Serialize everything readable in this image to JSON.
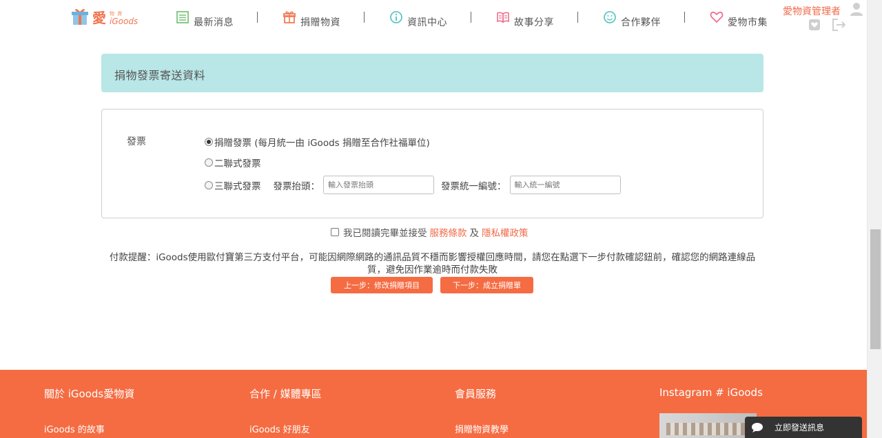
{
  "header": {
    "logo": {
      "main": "愛",
      "sub_top": "物 資",
      "sub_bottom": "iGoods"
    },
    "nav": [
      {
        "label": "最新消息",
        "icon": "news-list-icon"
      },
      {
        "label": "捐贈物資",
        "icon": "gift-box-icon"
      },
      {
        "label": "資訊中心",
        "icon": "info-circle-icon"
      },
      {
        "label": "故事分享",
        "icon": "open-book-icon"
      },
      {
        "label": "合作夥伴",
        "icon": "smile-face-icon"
      },
      {
        "label": "愛物市集",
        "icon": "heart-icon"
      }
    ],
    "user_name": "愛物資管理者"
  },
  "section": {
    "title": "捐物發票寄送資料"
  },
  "invoice": {
    "label": "發票",
    "options": [
      {
        "label": "捐贈發票 (每月統一由 iGoods 捐贈至合作社福單位)",
        "selected": true
      },
      {
        "label": "二聯式發票",
        "selected": false
      },
      {
        "label": "三聯式發票",
        "selected": false
      }
    ],
    "title_label": "發票抬頭：",
    "title_placeholder": "輸入發票抬頭",
    "taxid_label": "發票統一編號：",
    "taxid_placeholder": "輸入統一編號"
  },
  "agreement": {
    "prefix": "我已閱讀完畢並接受",
    "terms_link": "服務條款",
    "and": "及",
    "privacy_link": "隱私權政策",
    "checked": false
  },
  "notice": "付款提醒：iGoods使用歐付寶第三方支付平台，可能因網際網路的通訊品質不穩而影響授權回應時間，請您在點選下一步付款確認鈕前，確認您的網路連線品質，避免因作業逾時而付款失敗",
  "buttons": {
    "prev": "上一步：修改捐贈項目",
    "next": "下一步：成立捐贈單"
  },
  "footer": {
    "columns": [
      {
        "title": "關於 iGoods愛物資",
        "first_item": "iGoods 的故事"
      },
      {
        "title": "合作 / 媒體專區",
        "first_item": "iGoods 好朋友"
      },
      {
        "title": "會員服務",
        "first_item": "捐贈物資教學"
      },
      {
        "title": "Instagram # iGoods",
        "first_item": ""
      }
    ]
  },
  "chat": {
    "label": "立即發送訊息"
  },
  "colors": {
    "accent": "#f56c42",
    "heading_bg": "#b9e6e6",
    "nav_icon_green": "#7cc47a",
    "nav_icon_orange": "#f07c55",
    "nav_icon_teal": "#5ec6c6",
    "nav_icon_pink": "#f07090"
  }
}
